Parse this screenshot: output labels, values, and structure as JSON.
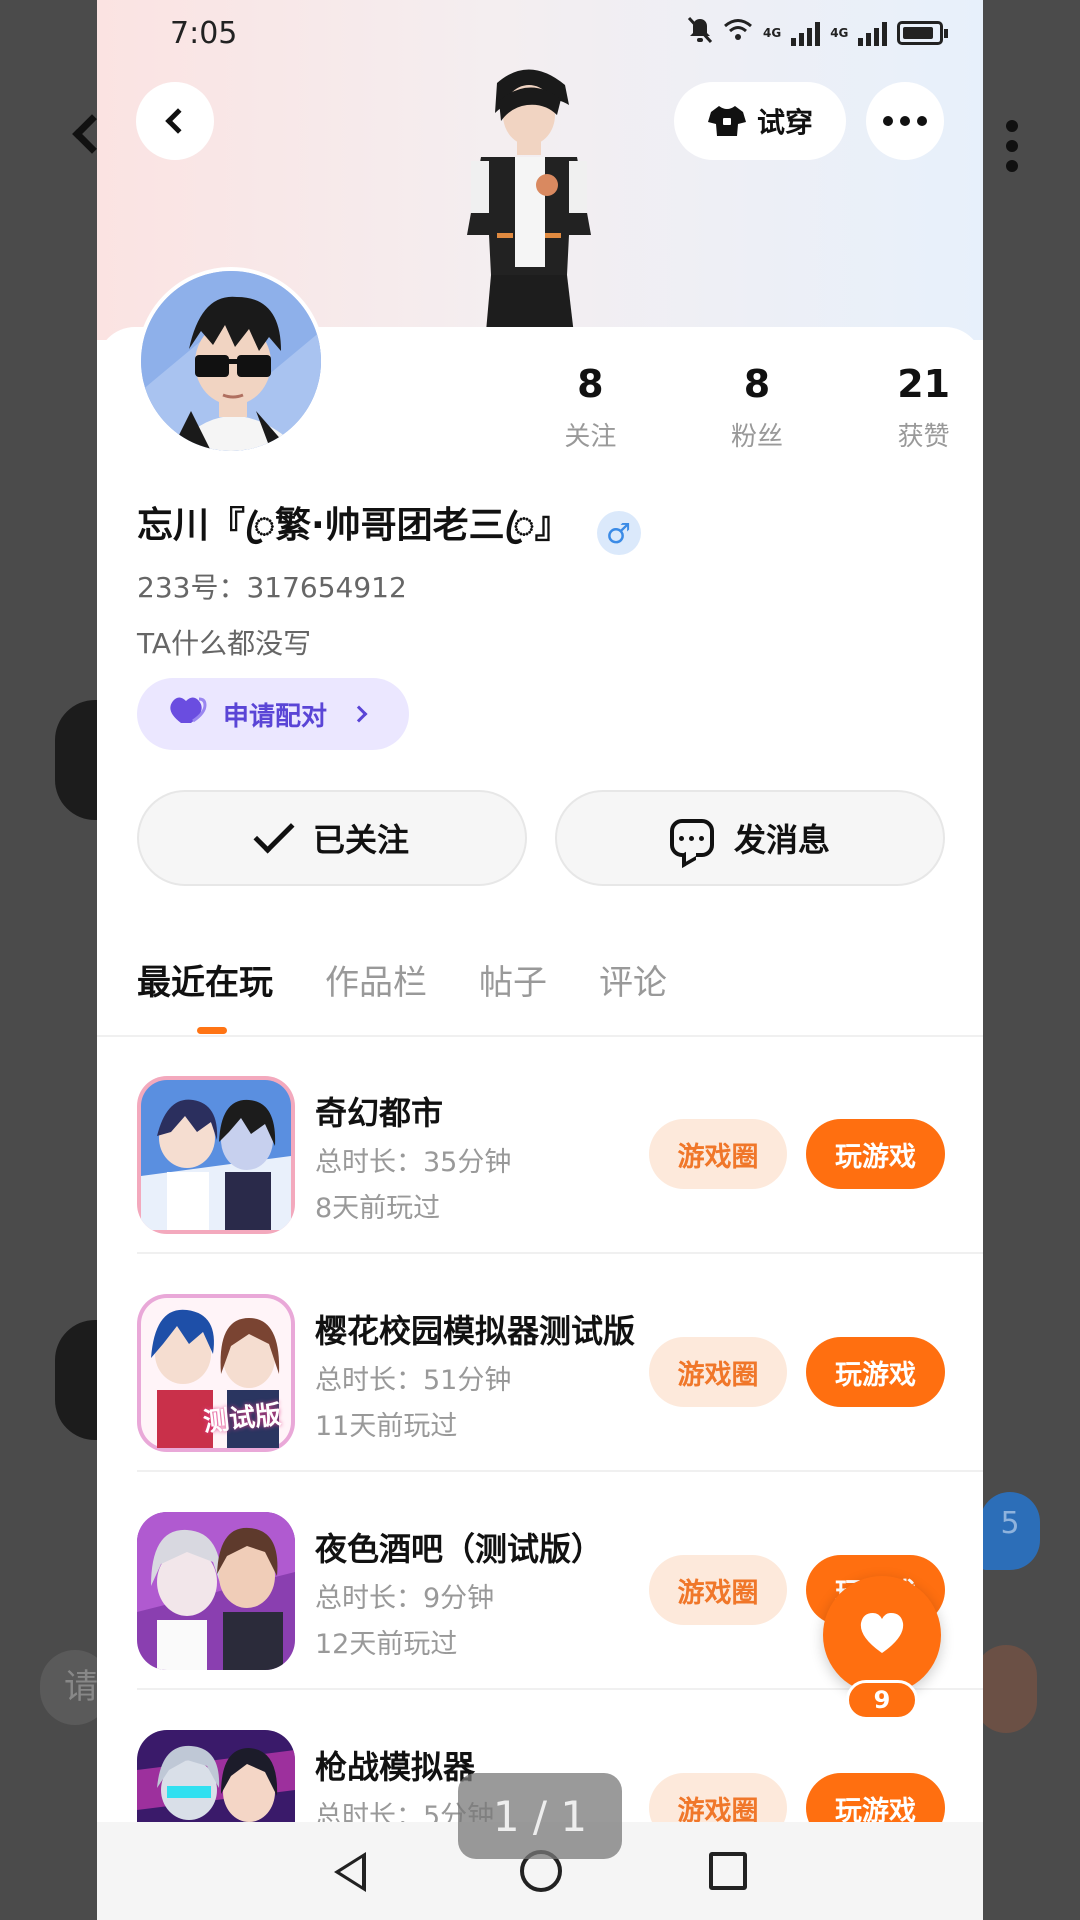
{
  "status_bar": {
    "time": "7:05",
    "network_1": "4G",
    "network_2": "4G"
  },
  "header": {
    "try_on_label": "试穿"
  },
  "stats": [
    {
      "value": "8",
      "label": "关注"
    },
    {
      "value": "8",
      "label": "粉丝"
    },
    {
      "value": "21",
      "label": "获赞"
    }
  ],
  "profile": {
    "username": "忘川『ꦿ繁·帅哥团老三ꦿ』",
    "gender_symbol": "♂",
    "uid_label": "233号：317654912",
    "bio": "TA什么都没写",
    "pair_button": "申请配对"
  },
  "actions": {
    "follow_label": "已关注",
    "message_label": "发消息"
  },
  "tabs": [
    "最近在玩",
    "作品栏",
    "帖子",
    "评论"
  ],
  "games": [
    {
      "name": "奇幻都市",
      "duration": "总时长：35分钟",
      "last_played": "8天前玩过",
      "circle_label": "游戏圈",
      "play_label": "玩游戏"
    },
    {
      "name": "樱花校园模拟器测试版",
      "duration": "总时长：51分钟",
      "last_played": "11天前玩过",
      "circle_label": "游戏圈",
      "play_label": "玩游戏",
      "icon_badge": "测试版"
    },
    {
      "name": "夜色酒吧（测试版）",
      "duration": "总时长：9分钟",
      "last_played": "12天前玩过",
      "circle_label": "游戏圈",
      "play_label": "玩游戏"
    },
    {
      "name": "枪战模拟器",
      "duration": "总时长：5分钟",
      "last_played": "",
      "circle_label": "游戏圈",
      "play_label": "玩游戏"
    }
  ],
  "like_fab": {
    "count": "9"
  },
  "page_indicator": "1 / 1",
  "backdrop": {
    "bubble_count": "5",
    "input_placeholder": "请"
  },
  "colors": {
    "accent": "#ff6f10",
    "accent_soft": "#fde9db",
    "pair_purple": "#5a45d6",
    "gender_blue": "#3b8be6"
  }
}
